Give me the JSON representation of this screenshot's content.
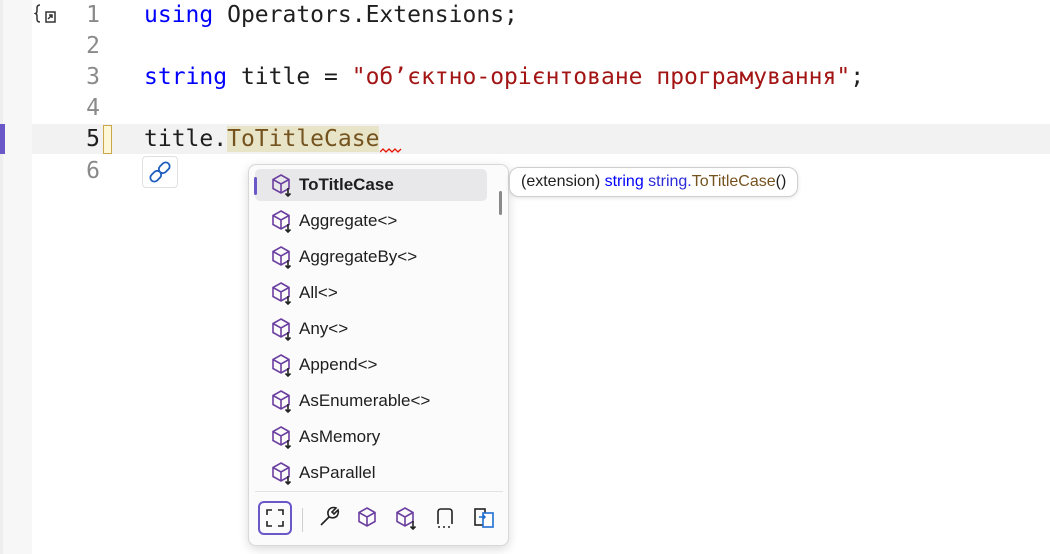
{
  "editor": {
    "line_numbers": [
      "1",
      "2",
      "3",
      "4",
      "5",
      "6"
    ],
    "code": {
      "line1": {
        "keyword": "using",
        "rest": " Operators.Extensions;"
      },
      "line3": {
        "keyword": "string",
        "ident": " title = ",
        "string": "\"об’єктно-орієнтоване програмування\"",
        "end": ";"
      },
      "line5": {
        "object": "title.",
        "method": "ToTitleCase"
      }
    }
  },
  "completion": {
    "items": [
      {
        "label": "ToTitleCase",
        "icon": "extension-method-icon",
        "selected": true
      },
      {
        "label": "Aggregate<>",
        "icon": "extension-method-icon"
      },
      {
        "label": "AggregateBy<>",
        "icon": "extension-method-icon"
      },
      {
        "label": "All<>",
        "icon": "extension-method-icon"
      },
      {
        "label": "Any<>",
        "icon": "extension-method-icon"
      },
      {
        "label": "Append<>",
        "icon": "extension-method-icon"
      },
      {
        "label": "AsEnumerable<>",
        "icon": "extension-method-icon"
      },
      {
        "label": "AsMemory",
        "icon": "extension-method-icon"
      },
      {
        "label": "AsParallel",
        "icon": "extension-method-icon"
      }
    ],
    "filters": [
      "expand-scope-icon",
      "wrench-icon",
      "method-filter-icon",
      "extension-method-filter-icon",
      "snippet-icon",
      "target-type-icon"
    ]
  },
  "tooltip": {
    "prefix": "(extension) ",
    "keyword": "string",
    "type": " string.",
    "method": "ToTitleCase",
    "suffix": "()"
  },
  "colors": {
    "accent": "#6b58c8",
    "keyword": "#0000ff",
    "string": "#a31515",
    "method": "#74531f"
  }
}
